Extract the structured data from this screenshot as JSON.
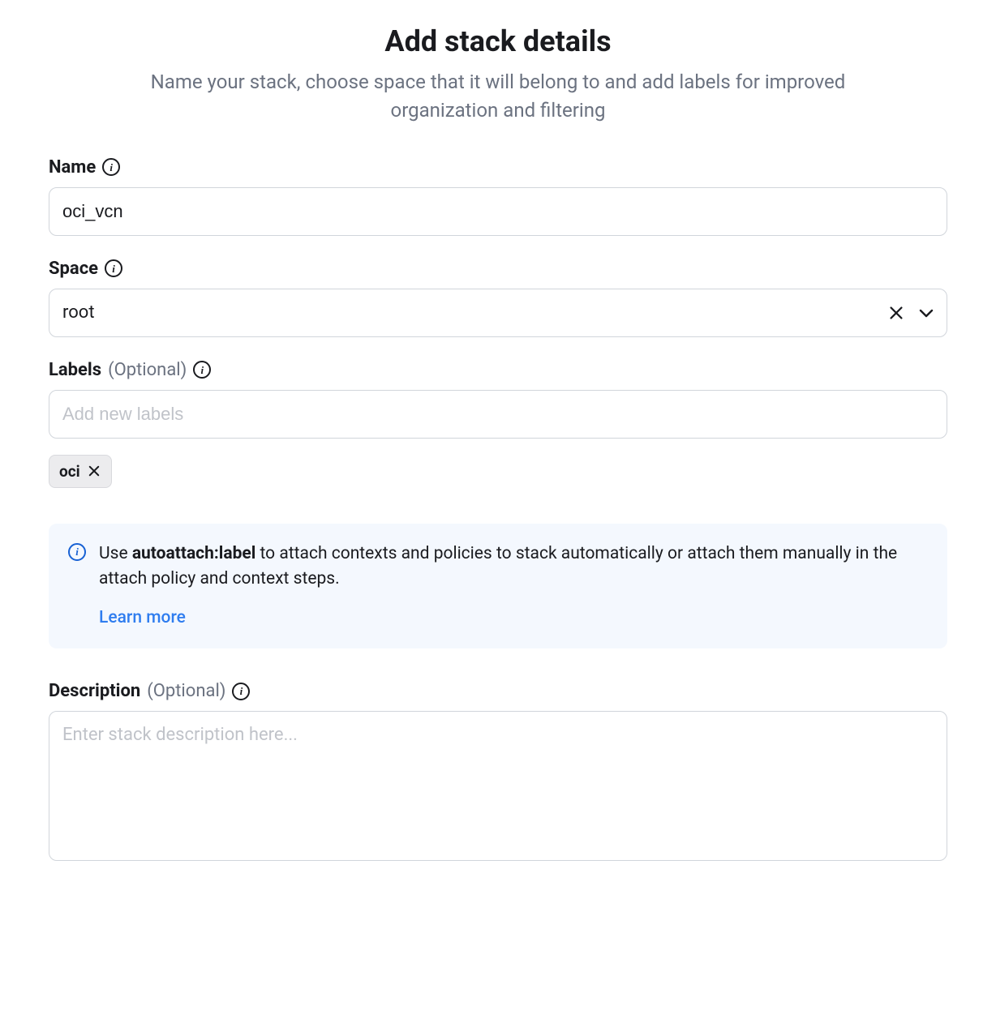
{
  "header": {
    "title": "Add stack details",
    "subtitle": "Name your stack, choose space that it will belong to and add labels for improved organization and filtering"
  },
  "fields": {
    "name": {
      "label": "Name",
      "value": "oci_vcn"
    },
    "space": {
      "label": "Space",
      "value": "root"
    },
    "labels": {
      "label": "Labels",
      "optional": "(Optional)",
      "placeholder": "Add new labels",
      "chips": [
        "oci"
      ]
    },
    "description": {
      "label": "Description",
      "optional": "(Optional)",
      "placeholder": "Enter stack description here..."
    }
  },
  "callout": {
    "pre": "Use ",
    "bold": "autoattach:label",
    "post": " to attach contexts and policies to stack automatically or attach them manually in the attach policy and context steps.",
    "learn_more": "Learn more"
  }
}
